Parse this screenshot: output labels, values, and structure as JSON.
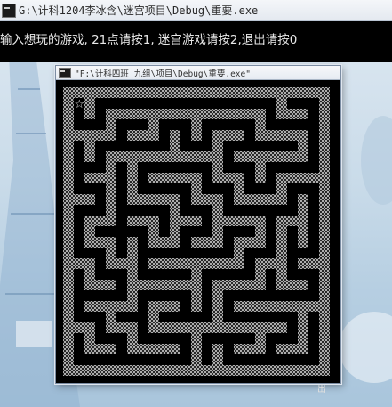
{
  "outer_window": {
    "title": "G:\\计科1204李冰含\\迷宫项目\\Debug\\重要.exe",
    "prompt": "输入想玩的游戏, 21点请按1, 迷宫游戏请按2,退出请按0"
  },
  "inner_window": {
    "title": "\"F:\\计科四班 九组\\项目\\Debug\\重要.exe\""
  },
  "maze": {
    "player_glyph": "☆",
    "exit_label": "出",
    "colors": {
      "wall": "#c8c8c8",
      "background": "#000000",
      "console_text": "#e8e8e8"
    }
  }
}
